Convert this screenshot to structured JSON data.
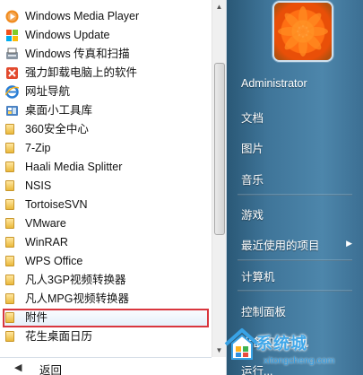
{
  "programs": [
    {
      "label": "Windows Media Player",
      "icon": "media-player-icon",
      "name": "prog-windows-media-player"
    },
    {
      "label": "Windows Update",
      "icon": "windows-update-icon",
      "name": "prog-windows-update"
    },
    {
      "label": "Windows 传真和扫描",
      "icon": "fax-scan-icon",
      "name": "prog-windows-fax-scan"
    },
    {
      "label": "强力卸载电脑上的软件",
      "icon": "uninstall-icon",
      "name": "prog-uninstall-tool"
    },
    {
      "label": "网址导航",
      "icon": "ie-icon",
      "name": "prog-url-navigation"
    },
    {
      "label": "桌面小工具库",
      "icon": "gadgets-icon",
      "name": "prog-desktop-gadgets"
    },
    {
      "label": "360安全中心",
      "icon": "folder-icon",
      "name": "folder-360-security"
    },
    {
      "label": "7-Zip",
      "icon": "folder-icon",
      "name": "folder-7zip"
    },
    {
      "label": "Haali Media Splitter",
      "icon": "folder-icon",
      "name": "folder-haali"
    },
    {
      "label": "NSIS",
      "icon": "folder-icon",
      "name": "folder-nsis"
    },
    {
      "label": "TortoiseSVN",
      "icon": "folder-icon",
      "name": "folder-tortoisesvn"
    },
    {
      "label": "VMware",
      "icon": "folder-icon",
      "name": "folder-vmware"
    },
    {
      "label": "WinRAR",
      "icon": "folder-icon",
      "name": "folder-winrar"
    },
    {
      "label": "WPS Office",
      "icon": "folder-icon",
      "name": "folder-wps-office"
    },
    {
      "label": "凡人3GP视频转换器",
      "icon": "folder-icon",
      "name": "folder-3gp-converter"
    },
    {
      "label": "凡人MPG视频转换器",
      "icon": "folder-icon",
      "name": "folder-mpg-converter"
    },
    {
      "label": "附件",
      "icon": "folder-icon",
      "name": "folder-accessories",
      "selected": true
    },
    {
      "label": "花生桌面日历",
      "icon": "folder-icon",
      "name": "folder-desktop-calendar"
    }
  ],
  "back_label": "返回",
  "right_menu": {
    "username": "Administrator",
    "documents": "文档",
    "pictures": "图片",
    "music": "音乐",
    "games": "游戏",
    "recent_items": "最近使用的项目",
    "computer": "计算机",
    "control_panel": "控制面板",
    "devices_printers": "设备和打印机",
    "run": "运行..."
  },
  "watermark": {
    "brand": "系统城",
    "url": "xitongcheng.com"
  },
  "colors": {
    "selection_outline": "#d9363e",
    "right_pane": "#3f7599",
    "watermark": "#3fa7e9"
  }
}
